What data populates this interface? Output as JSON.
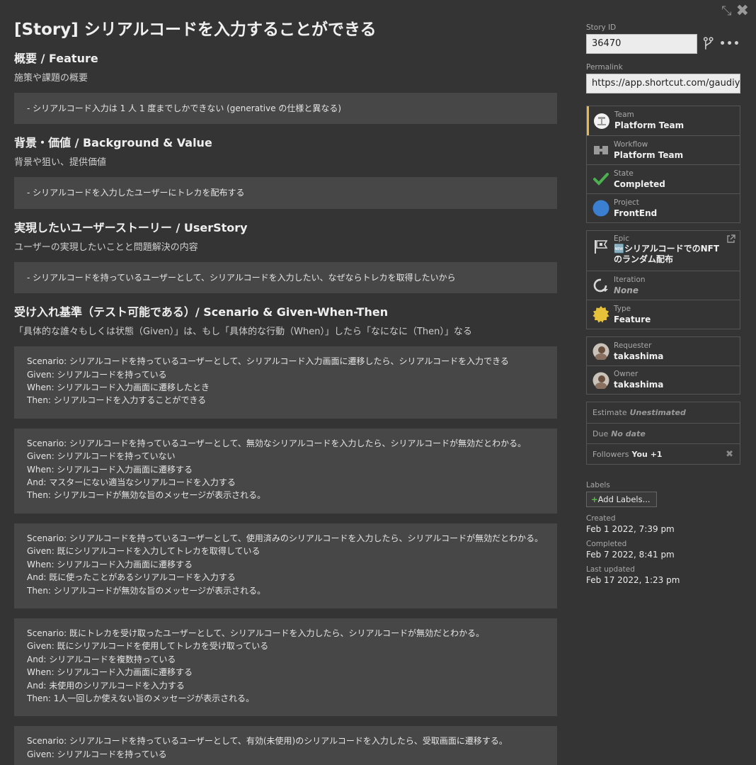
{
  "story": {
    "title": "[Story] シリアルコードを入力することができる",
    "sections": [
      {
        "heading": "概要 / Feature",
        "desc": "施策や課題の概要",
        "blocks": [
          [
            "- シリアルコード入力は 1 人 1 度までしかできない (generative の仕様と異なる)"
          ]
        ]
      },
      {
        "heading": "背景・価値 / Background & Value",
        "desc": "背景や狙い、提供価値",
        "blocks": [
          [
            "- シリアルコードを入力したユーザーにトレカを配布する"
          ]
        ]
      },
      {
        "heading": "実現したいユーザーストーリー / UserStory",
        "desc": "ユーザーの実現したいことと問題解決の内容",
        "blocks": [
          [
            "- シリアルコードを持っているユーザーとして、シリアルコードを入力したい、なぜならトレカを取得したいから"
          ]
        ]
      },
      {
        "heading": "受け入れ基準（テスト可能である）/ Scenario & Given-When-Then",
        "desc": "「具体的な誰々もしくは状態（Given）」は、もし「具体的な行動（When）」したら「なになに（Then）」なる",
        "blocks": [
          [
            "Scenario: シリアルコードを持っているユーザーとして、シリアルコード入力画面に遷移したら、シリアルコードを入力できる",
            "Given: シリアルコードを持っている",
            "When: シリアルコード入力画面に遷移したとき",
            "Then: シリアルコードを入力することができる"
          ],
          [
            "Scenario: シリアルコードを持っているユーザーとして、無効なシリアルコードを入力したら、シリアルコードが無効だとわかる。",
            "Given: シリアルコードを持っていない",
            "When: シリアルコード入力画面に遷移する",
            "And: マスターにない適当なシリアルコードを入力する",
            "Then: シリアルコードが無効な旨のメッセージが表示される。"
          ],
          [
            "Scenario: シリアルコードを持っているユーザーとして、使用済みのシリアルコードを入力したら、シリアルコードが無効だとわかる。",
            "Given: 既にシリアルコードを入力してトレカを取得している",
            "When: シリアルコード入力画面に遷移する",
            "And: 既に使ったことがあるシリアルコードを入力する",
            "Then: シリアルコードが無効な旨のメッセージが表示される。"
          ],
          [
            "Scenario: 既にトレカを受け取ったユーザーとして、シリアルコードを入力したら、シリアルコードが無効だとわかる。",
            "Given: 既にシリアルコードを使用してトレカを受け取っている",
            "And: シリアルコードを複数持っている",
            "When: シリアルコード入力画面に遷移する",
            "And: 未使用のシリアルコードを入力する",
            "Then: 1人一回しか使えない旨のメッセージが表示される。"
          ],
          [
            "Scenario: シリアルコードを持っているユーザーとして、有効(未使用)のシリアルコードを入力したら、受取画面に遷移する。",
            "Given: シリアルコードを持っている"
          ]
        ]
      }
    ]
  },
  "sidebar": {
    "story_id_label": "Story ID",
    "story_id": "36470",
    "permalink_label": "Permalink",
    "permalink": "https://app.shortcut.com/gaudiy",
    "team": {
      "label": "Team",
      "value": "Platform Team"
    },
    "workflow": {
      "label": "Workflow",
      "value": "Platform Team"
    },
    "state": {
      "label": "State",
      "value": "Completed",
      "color": "#4caf50"
    },
    "project": {
      "label": "Project",
      "value": "FrontEnd",
      "color": "#3b7fd0"
    },
    "epic": {
      "label": "Epic",
      "value": "🆕シリアルコードでのNFTのランダム配布"
    },
    "iteration": {
      "label": "Iteration",
      "value": "None"
    },
    "type": {
      "label": "Type",
      "value": "Feature",
      "color": "#e6c23a"
    },
    "requester": {
      "label": "Requester",
      "value": "takashima"
    },
    "owner": {
      "label": "Owner",
      "value": "takashima"
    },
    "estimate": {
      "label": "Estimate",
      "value": "Unestimated"
    },
    "due": {
      "label": "Due",
      "value": "No date"
    },
    "followers": {
      "label": "Followers",
      "value": "You +1"
    },
    "labels_label": "Labels",
    "add_labels": "Add Labels...",
    "created_label": "Created",
    "created": "Feb 1 2022, 7:39 pm",
    "completed_label": "Completed",
    "completed": "Feb 7 2022, 8:41 pm",
    "updated_label": "Last updated",
    "updated": "Feb 17 2022, 1:23 pm"
  }
}
